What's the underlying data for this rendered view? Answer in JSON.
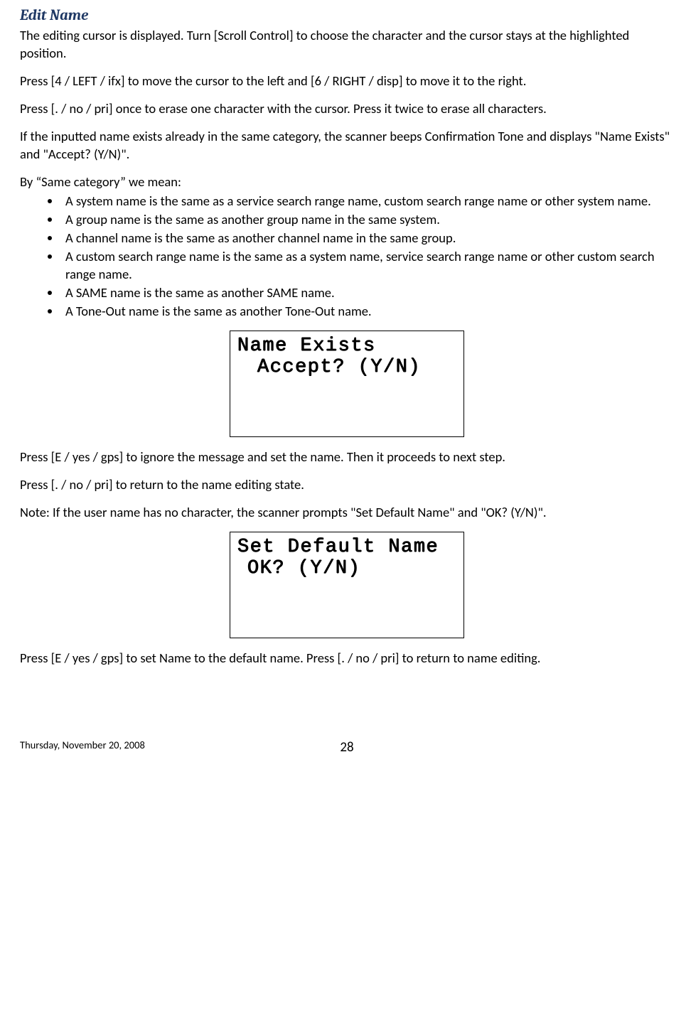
{
  "title": "Edit Name",
  "para1": "The editing cursor is displayed. Turn [Scroll Control] to choose the character and the cursor stays at the highlighted position.",
  "para2": "Press [4 / LEFT / ifx] to move the cursor to the left and [6 / RIGHT / disp] to move it to the right.",
  "para3": "Press [. / no / pri] once to erase one character with the cursor. Press it twice to erase all characters.",
  "para4": "If the inputted name exists already in the same category, the scanner beeps Confirmation Tone and displays \"Name Exists\" and \"Accept? (Y/N)\".",
  "para5": "By “Same category” we mean:",
  "bullets": [
    "A system name is the same as a service search range name, custom search range name or other system name.",
    "A group name is the same as another group name in the same system.",
    "A channel name is the same as another channel name in the same group.",
    "A custom search range name is the same as a system name, service search range name or other custom search range name.",
    "A SAME name is the same as another SAME name.",
    "A Tone-Out name is the same as another Tone-Out name."
  ],
  "lcd1": {
    "line1": "Name Exists",
    "line2": "Accept? (Y/N)"
  },
  "para6": "Press [E / yes / gps] to ignore the message and set the name. Then it proceeds to next step.",
  "para7": "Press [. / no / pri] to return to the name editing state.",
  "para8": "Note: If the user name has no character, the scanner prompts \"Set Default Name\" and \"OK? (Y/N)\".",
  "lcd2": {
    "line1": "Set Default Name",
    "line2": "OK? (Y/N)"
  },
  "para9": "Press [E / yes / gps] to set Name to the default name. Press [. / no / pri] to return to name editing.",
  "footer": {
    "date": "Thursday, November 20, 2008",
    "page": "28"
  }
}
